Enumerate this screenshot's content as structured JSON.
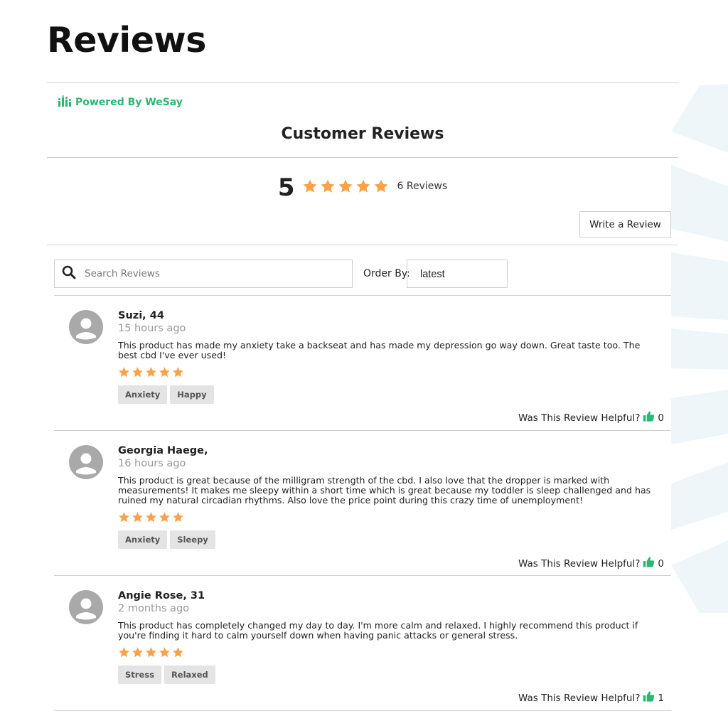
{
  "page": {
    "title": "Reviews"
  },
  "widget": {
    "powered_by": "Powered By WeSay",
    "section_title": "Customer Reviews",
    "average_rating": "5",
    "rating_value": 5,
    "rating_max": 5,
    "review_count": "6 Reviews",
    "write_review_label": "Write a Review",
    "search": {
      "placeholder": "Search Reviews",
      "value": ""
    },
    "order_by": {
      "label": "Order By:",
      "selected": "latest"
    },
    "colors": {
      "star": "#f9a24a",
      "brand_green": "#2bb673",
      "thumb": "#2bb673"
    },
    "helpful_label": "Was This Review Helpful?"
  },
  "reviews": [
    {
      "name": "Suzi, 44",
      "time": "15 hours ago",
      "text": "This product has made my anxiety take a backseat and has made my depression go way down. Great taste too. The best cbd I've ever used!",
      "rating": 5,
      "tags": [
        "Anxiety",
        "Happy"
      ],
      "helpful_count": "0"
    },
    {
      "name": "Georgia Haege,",
      "time": "16 hours ago",
      "text": "This product is great because of the milligram strength of the cbd. I also love that the dropper is marked with measurements! It makes me sleepy within a short time which is great because my toddler is sleep challenged and has ruined my natural circadian rhythms. Also love the price point during this crazy time of unemployment!",
      "rating": 5,
      "tags": [
        "Anxiety",
        "Sleepy"
      ],
      "helpful_count": "0"
    },
    {
      "name": "Angie Rose, 31",
      "time": "2 months ago",
      "text": "This product has completely changed my day to day. I'm more calm and relaxed. I highly recommend this product if you're finding it hard to calm yourself down when having panic attacks or general stress.",
      "rating": 5,
      "tags": [
        "Stress",
        "Relaxed"
      ],
      "helpful_count": "1"
    }
  ]
}
